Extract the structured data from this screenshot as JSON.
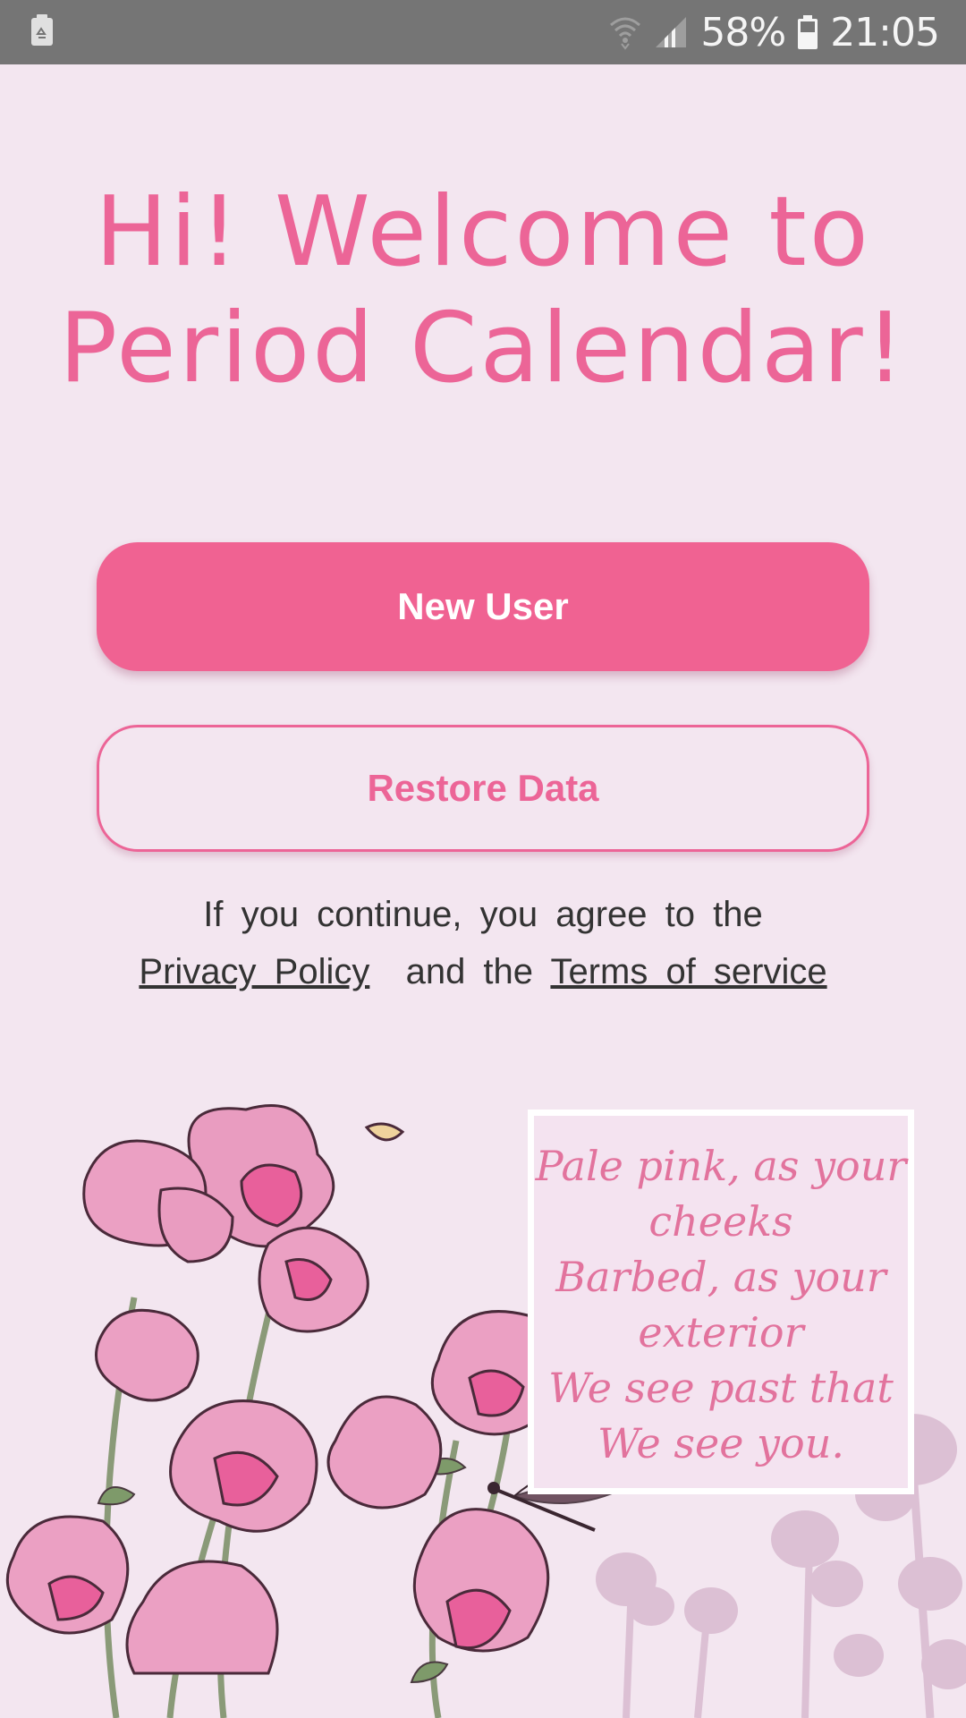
{
  "status_bar": {
    "battery_percent": "58%",
    "time": "21:05",
    "icons": [
      "recycle-notification-icon",
      "wifi-icon",
      "signal-icon",
      "battery-icon"
    ]
  },
  "welcome": {
    "title_line1": "Hi! Welcome to",
    "title_line2": "Period Calendar!"
  },
  "buttons": {
    "new_user": "New User",
    "restore_data": "Restore Data"
  },
  "agreement": {
    "line1": "If you continue, you agree to the",
    "privacy_link": "Privacy Policy",
    "middle": "and the",
    "terms_link": "Terms of service"
  },
  "poem": {
    "lines": [
      "Pale pink, as your",
      "cheeks",
      "Barbed, as your",
      "exterior",
      "We see past that",
      "We see you."
    ]
  },
  "colors": {
    "background": "#f3e6f0",
    "accent": "#f06292",
    "title": "#ec6597",
    "status_bar": "#757575"
  }
}
